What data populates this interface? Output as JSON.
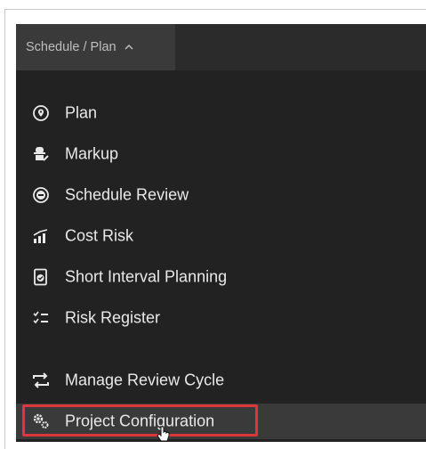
{
  "breadcrumb": {
    "text": "Schedule / Plan",
    "caret_icon": "chevron-up-icon"
  },
  "menu": {
    "items": [
      {
        "label": "Plan",
        "icon": "map-pin-icon"
      },
      {
        "label": "Markup",
        "icon": "markup-icon"
      },
      {
        "label": "Schedule Review",
        "icon": "review-icon"
      },
      {
        "label": "Cost Risk",
        "icon": "bar-chart-icon"
      },
      {
        "label": "Short Interval Planning",
        "icon": "checklist-doc-icon"
      },
      {
        "label": "Risk Register",
        "icon": "checklist-icon"
      },
      {
        "label": "Manage Review Cycle",
        "icon": "cycle-icon"
      },
      {
        "label": "Project Configuration",
        "icon": "gears-icon",
        "active": true
      }
    ]
  },
  "colors": {
    "highlight": "#e0353b",
    "panel": "#222222",
    "active_row": "#3a3a3a"
  }
}
